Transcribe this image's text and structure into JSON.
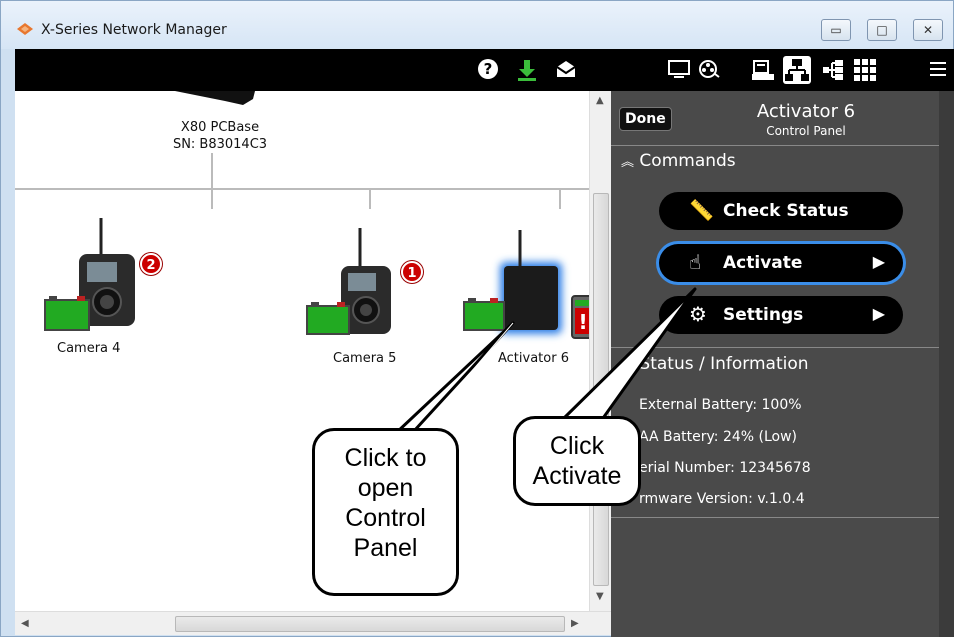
{
  "window": {
    "title": "X-Series Network Manager"
  },
  "toolbar": {
    "icons": [
      "help-icon",
      "download-icon",
      "mail-icon",
      "monitor-icon",
      "camera-reel-icon",
      "print-icon",
      "network-icon",
      "topology-icon",
      "grid-icon",
      "menu-icon"
    ]
  },
  "canvas": {
    "pcbase_name": "X80 PCBase",
    "pcbase_sn": "SN: B83014C3",
    "devices": [
      {
        "label": "Camera 4",
        "badge": "2"
      },
      {
        "label": "Camera 5",
        "badge": "1"
      },
      {
        "label": "Activator 6",
        "badge": "!"
      }
    ]
  },
  "panel": {
    "done_label": "Done",
    "title": "Activator 6",
    "subtitle": "Control Panel",
    "commands_header": "Commands",
    "commands": [
      {
        "label": "Check Status"
      },
      {
        "label": "Activate"
      },
      {
        "label": "Settings"
      }
    ],
    "status_header": "Status / Information",
    "status_lines": [
      "External Battery: 100%",
      "AA Battery: 24% (Low)",
      "erial Number: 12345678",
      "rmware Version: v.1.0.4"
    ]
  },
  "callouts": {
    "left": "Click to open Control Panel",
    "right": "Click Activate"
  },
  "colors": {
    "accent": "#3a8de8",
    "panel_bg": "#4a4a4a",
    "badge": "#cc0000",
    "battery": "#22aa22"
  }
}
